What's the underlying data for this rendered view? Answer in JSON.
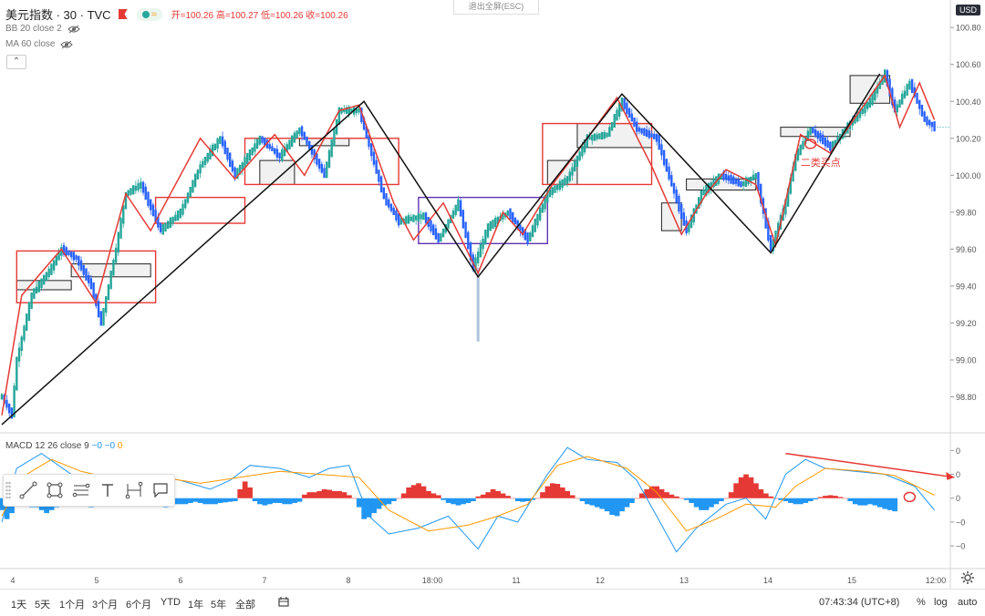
{
  "header": {
    "symbol": "美元指数 · 30 · TVC",
    "ohlc": "开=100.26 高=100.27 低=100.26 收=100.26",
    "wave_icon": "≈"
  },
  "indicators": [
    {
      "label": "BB 20 close 2"
    },
    {
      "label": "MA 60 close"
    }
  ],
  "collapse_icon": "⌃",
  "exit_fullscreen": "退出全屏(ESC)",
  "currency": "USD",
  "macd_header": {
    "label": "MACD 12 26 close 9",
    "v1": "−0",
    "v2": "−0",
    "v3": "0"
  },
  "annotation": "二类买点",
  "colors": {
    "up": "#26a69a",
    "down": "#2962ff",
    "box_red": "#e53935",
    "box_purple": "#5e35b1",
    "zigzag": "#111111",
    "macd_line": "#2196f3",
    "signal_line": "#ff9800"
  },
  "toolbar_icons": [
    "trend-line-icon",
    "rectangle-icon",
    "fib-icon",
    "text-icon",
    "measure-icon",
    "comment-icon"
  ],
  "bottom": {
    "ranges": [
      "1天",
      "5天",
      "1个月",
      "3个月",
      "6个月",
      "YTD",
      "1年",
      "5年",
      "全部"
    ],
    "clock": "07:43:34 (UTC+8)",
    "percent": "%",
    "log": "log",
    "auto": "auto"
  },
  "chart_data": {
    "type": "candlestick",
    "x_ticks": [
      "4",
      "5",
      "6",
      "7",
      "8",
      "18:00",
      "11",
      "12",
      "13",
      "14",
      "15",
      "12:00"
    ],
    "y_ticks": [
      98.8,
      99.0,
      99.2,
      99.4,
      99.6,
      99.8,
      100.0,
      100.2,
      100.4,
      100.6,
      100.8
    ],
    "ylim": [
      98.62,
      100.87
    ],
    "last_price": 100.26,
    "stroke_path_points": [
      [
        0,
        98.8
      ],
      [
        2,
        98.7
      ],
      [
        3,
        99.0
      ],
      [
        6,
        99.35
      ],
      [
        10,
        99.5
      ],
      [
        12,
        99.6
      ],
      [
        15,
        99.55
      ],
      [
        18,
        99.4
      ],
      [
        20,
        99.2
      ],
      [
        23,
        99.6
      ],
      [
        25,
        99.9
      ],
      [
        28,
        99.95
      ],
      [
        32,
        99.7
      ],
      [
        36,
        99.8
      ],
      [
        40,
        100.05
      ],
      [
        44,
        100.2
      ],
      [
        47,
        100.0
      ],
      [
        52,
        100.2
      ],
      [
        56,
        100.1
      ],
      [
        60,
        100.25
      ],
      [
        65,
        100.0
      ],
      [
        68,
        100.35
      ],
      [
        72,
        100.35
      ],
      [
        77,
        99.88
      ],
      [
        80,
        99.75
      ],
      [
        85,
        99.78
      ],
      [
        88,
        99.65
      ],
      [
        92,
        99.85
      ],
      [
        95,
        99.5
      ],
      [
        98,
        99.72
      ],
      [
        102,
        99.8
      ],
      [
        106,
        99.65
      ],
      [
        110,
        99.9
      ],
      [
        114,
        99.98
      ],
      [
        118,
        100.2
      ],
      [
        122,
        100.22
      ],
      [
        125,
        100.4
      ],
      [
        128,
        100.25
      ],
      [
        132,
        100.2
      ],
      [
        135,
        99.95
      ],
      [
        138,
        99.7
      ],
      [
        141,
        99.9
      ],
      [
        145,
        100.0
      ],
      [
        149,
        99.95
      ],
      [
        152,
        100.0
      ],
      [
        155,
        99.6
      ],
      [
        158,
        99.85
      ],
      [
        160,
        100.1
      ],
      [
        163,
        100.25
      ],
      [
        167,
        100.15
      ],
      [
        171,
        100.28
      ],
      [
        175,
        100.4
      ],
      [
        178,
        100.55
      ],
      [
        180,
        100.35
      ],
      [
        183,
        100.5
      ],
      [
        186,
        100.3
      ],
      [
        188,
        100.26
      ]
    ],
    "zigzag_black": [
      [
        0,
        98.65
      ],
      [
        73,
        100.4
      ],
      [
        96,
        99.45
      ],
      [
        125,
        100.44
      ],
      [
        155,
        99.58
      ],
      [
        177,
        100.55
      ]
    ],
    "zigzag_red": [
      [
        0,
        98.7
      ],
      [
        4,
        99.35
      ],
      [
        12,
        99.6
      ],
      [
        19,
        99.31
      ],
      [
        25,
        99.9
      ],
      [
        30,
        99.7
      ],
      [
        40,
        100.2
      ],
      [
        47,
        99.98
      ],
      [
        55,
        100.22
      ],
      [
        61,
        100.0
      ],
      [
        68,
        100.35
      ],
      [
        72,
        100.38
      ],
      [
        79,
        99.85
      ],
      [
        83,
        99.65
      ],
      [
        89,
        99.85
      ],
      [
        96,
        99.47
      ],
      [
        101,
        99.8
      ],
      [
        105,
        99.68
      ],
      [
        111,
        99.95
      ],
      [
        118,
        100.2
      ],
      [
        124,
        100.42
      ],
      [
        131,
        100.05
      ],
      [
        137,
        99.68
      ],
      [
        142,
        99.9
      ],
      [
        146,
        100.03
      ],
      [
        152,
        99.95
      ],
      [
        156,
        99.62
      ],
      [
        161,
        100.22
      ],
      [
        167,
        100.12
      ],
      [
        173,
        100.35
      ],
      [
        178,
        100.54
      ],
      [
        181,
        100.26
      ],
      [
        185,
        100.5
      ],
      [
        188,
        100.3
      ]
    ],
    "boxes_red": [
      {
        "x": [
          3,
          31
        ],
        "y": [
          99.31,
          99.59
        ]
      },
      {
        "x": [
          31,
          49
        ],
        "y": [
          99.74,
          99.88
        ]
      },
      {
        "x": [
          49,
          80
        ],
        "y": [
          99.95,
          100.2
        ]
      },
      {
        "x": [
          109,
          131
        ],
        "y": [
          99.95,
          100.28
        ]
      }
    ],
    "box_purple": {
      "x": [
        84,
        110
      ],
      "y": [
        99.63,
        99.88
      ]
    },
    "boxes_black": [
      {
        "x": [
          3,
          14
        ],
        "y": [
          99.38,
          99.43
        ]
      },
      {
        "x": [
          14,
          30
        ],
        "y": [
          99.45,
          99.52
        ]
      },
      {
        "x": [
          52,
          59
        ],
        "y": [
          99.95,
          100.08
        ]
      },
      {
        "x": [
          60,
          70
        ],
        "y": [
          100.16,
          100.2
        ]
      },
      {
        "x": [
          110,
          116
        ],
        "y": [
          99.95,
          100.08
        ]
      },
      {
        "x": [
          116,
          131
        ],
        "y": [
          100.15,
          100.28
        ]
      },
      {
        "x": [
          133,
          137
        ],
        "y": [
          99.7,
          99.85
        ]
      },
      {
        "x": [
          138,
          152
        ],
        "y": [
          99.92,
          99.98
        ]
      },
      {
        "x": [
          157,
          171
        ],
        "y": [
          100.21,
          100.26
        ]
      },
      {
        "x": [
          171,
          179
        ],
        "y": [
          100.39,
          100.54
        ]
      }
    ],
    "macd": {
      "ylim": [
        -1.15,
        1.05
      ],
      "ticks": [
        0.8,
        0.4,
        0.0,
        -0.4,
        -0.8
      ],
      "tick_labels": [
        "0",
        "0",
        "0",
        "−0",
        "−0"
      ],
      "hist": [
        -0.2,
        -0.35,
        -0.25,
        -0.1,
        -0.1,
        -0.1,
        -0.15,
        -0.15,
        -0.2,
        -0.25,
        -0.2,
        -0.15,
        -0.12,
        -0.1,
        -0.1,
        -0.08,
        -0.1,
        -0.12,
        -0.15,
        -0.12,
        -0.1,
        -0.1,
        -0.08,
        -0.05,
        -0.06,
        -0.08,
        -0.1,
        -0.1,
        -0.1,
        -0.1,
        -0.08,
        -0.08,
        -0.12,
        -0.15,
        -0.12,
        -0.1,
        -0.1,
        -0.1,
        -0.08,
        -0.06,
        -0.08,
        -0.1,
        -0.1,
        -0.1,
        -0.08,
        -0.07,
        -0.06,
        -0.05,
        0.15,
        0.28,
        0.18,
        -0.05,
        -0.1,
        -0.12,
        -0.1,
        -0.08,
        -0.08,
        -0.1,
        -0.1,
        -0.08,
        -0.06,
        0.06,
        0.1,
        0.1,
        0.12,
        0.15,
        0.14,
        0.12,
        0.12,
        0.1,
        0.05,
        0.0,
        -0.15,
        -0.35,
        -0.32,
        -0.25,
        -0.18,
        -0.12,
        -0.1,
        -0.05,
        0.0,
        0.08,
        0.18,
        0.22,
        0.25,
        0.2,
        0.12,
        0.08,
        0.05,
        -0.03,
        -0.08,
        -0.1,
        -0.12,
        -0.1,
        -0.08,
        -0.05,
        0.03,
        0.06,
        0.1,
        0.15,
        0.12,
        0.08,
        0.04,
        0.0,
        -0.05,
        -0.06,
        -0.05,
        -0.03,
        0.0,
        0.1,
        0.2,
        0.25,
        0.24,
        0.18,
        0.12,
        0.05,
        0.0,
        -0.05,
        -0.1,
        -0.12,
        -0.15,
        -0.18,
        -0.22,
        -0.28,
        -0.3,
        -0.22,
        -0.15,
        -0.08,
        0.0,
        0.08,
        0.15,
        0.2,
        0.2,
        0.15,
        0.1,
        0.06,
        0.03,
        0.0,
        -0.03,
        -0.08,
        -0.15,
        -0.2,
        -0.2,
        -0.15,
        -0.1,
        -0.05,
        0.0,
        0.1,
        0.25,
        0.35,
        0.4,
        0.35,
        0.25,
        0.15,
        0.08,
        0.03,
        0.0,
        -0.03,
        -0.05,
        -0.08,
        -0.1,
        -0.1,
        -0.08,
        -0.05,
        -0.02,
        0.02,
        0.04,
        0.05,
        0.04,
        0.02,
        0.0,
        -0.05,
        -0.1,
        -0.12,
        -0.12,
        -0.1,
        -0.12,
        -0.15,
        -0.18,
        -0.2,
        -0.22
      ],
      "macd_line": [
        [
          0,
          -0.4
        ],
        [
          3,
          0.5
        ],
        [
          8,
          0.75
        ],
        [
          14,
          0.4
        ],
        [
          20,
          0.2
        ],
        [
          26,
          0.35
        ],
        [
          30,
          0.4
        ],
        [
          36,
          0.3
        ],
        [
          42,
          0.15
        ],
        [
          46,
          0.3
        ],
        [
          50,
          0.55
        ],
        [
          56,
          0.5
        ],
        [
          62,
          0.35
        ],
        [
          66,
          0.5
        ],
        [
          70,
          0.55
        ],
        [
          74,
          -0.3
        ],
        [
          78,
          -0.6
        ],
        [
          84,
          -0.5
        ],
        [
          90,
          -0.3
        ],
        [
          96,
          -0.85
        ],
        [
          100,
          -0.3
        ],
        [
          104,
          -0.4
        ],
        [
          110,
          0.4
        ],
        [
          114,
          0.85
        ],
        [
          118,
          0.65
        ],
        [
          124,
          0.6
        ],
        [
          128,
          0.3
        ],
        [
          132,
          -0.3
        ],
        [
          136,
          -0.9
        ],
        [
          140,
          -0.5
        ],
        [
          146,
          -0.1
        ],
        [
          150,
          0.0
        ],
        [
          154,
          -0.35
        ],
        [
          158,
          0.4
        ],
        [
          162,
          0.65
        ],
        [
          166,
          0.5
        ],
        [
          172,
          0.45
        ],
        [
          178,
          0.4
        ],
        [
          184,
          0.2
        ],
        [
          188,
          -0.2
        ]
      ],
      "signal_line": [
        [
          0,
          -0.3
        ],
        [
          4,
          0.35
        ],
        [
          10,
          0.65
        ],
        [
          16,
          0.45
        ],
        [
          24,
          0.3
        ],
        [
          32,
          0.35
        ],
        [
          40,
          0.25
        ],
        [
          48,
          0.35
        ],
        [
          56,
          0.45
        ],
        [
          64,
          0.4
        ],
        [
          72,
          0.35
        ],
        [
          78,
          -0.2
        ],
        [
          86,
          -0.55
        ],
        [
          94,
          -0.45
        ],
        [
          100,
          -0.3
        ],
        [
          106,
          -0.1
        ],
        [
          112,
          0.55
        ],
        [
          118,
          0.7
        ],
        [
          126,
          0.5
        ],
        [
          132,
          0.1
        ],
        [
          138,
          -0.55
        ],
        [
          144,
          -0.35
        ],
        [
          150,
          -0.1
        ],
        [
          156,
          -0.15
        ],
        [
          160,
          0.2
        ],
        [
          166,
          0.5
        ],
        [
          174,
          0.45
        ],
        [
          180,
          0.38
        ],
        [
          188,
          0.05
        ]
      ]
    }
  }
}
